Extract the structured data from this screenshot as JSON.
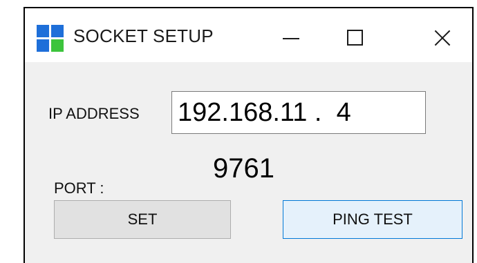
{
  "window": {
    "title": "SOCKET SETUP",
    "icon": "windows-logo-icon",
    "icon_colors": [
      "#1e6fd9",
      "#1e6fd9",
      "#1e6fd9",
      "#3cc43c"
    ],
    "controls": {
      "minimize": "minimize-icon",
      "maximize": "maximize-icon",
      "close": "close-icon"
    }
  },
  "form": {
    "ip_label": "IP ADDRESS",
    "ip_value": "192.168.11 .  4",
    "port_label": "PORT :",
    "port_value": "9761"
  },
  "buttons": {
    "set_label": "SET",
    "ping_label": "PING TEST"
  },
  "colors": {
    "window_bg": "#f0f0f0",
    "titlebar_bg": "#ffffff",
    "set_button_bg": "#e1e1e1",
    "ping_button_bg": "#e5f1fb",
    "ping_button_border": "#0078d7"
  }
}
